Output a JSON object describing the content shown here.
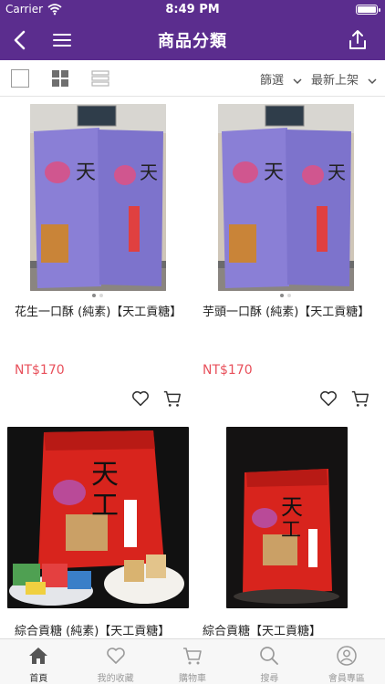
{
  "status_bar": {
    "carrier": "Carrier",
    "time": "8:49 PM"
  },
  "nav": {
    "title": "商品分類"
  },
  "toolbar": {
    "filter_label": "篩選",
    "sort_label": "最新上架"
  },
  "products": [
    {
      "name": "花生一口酥 (純素)【天工貢糖】",
      "price": "NT$170",
      "image": "purple-candy-bags"
    },
    {
      "name": "芋頭一口酥 (純素)【天工貢糖】",
      "price": "NT$170",
      "image": "purple-candy-bags"
    },
    {
      "name": "綜合貢糖 (純素)【天工貢糖】",
      "price": "",
      "image": "red-bag-with-sweets"
    },
    {
      "name": "綜合貢糖【天工貢糖】",
      "price": "",
      "image": "red-bag-dark-background"
    }
  ],
  "tabs": [
    {
      "label": "首頁",
      "icon": "home-icon",
      "active": true
    },
    {
      "label": "我的收藏",
      "icon": "heart-icon",
      "active": false
    },
    {
      "label": "購物車",
      "icon": "cart-icon",
      "active": false
    },
    {
      "label": "搜尋",
      "icon": "search-icon",
      "active": false
    },
    {
      "label": "會員專區",
      "icon": "user-icon",
      "active": false
    }
  ],
  "colors": {
    "brand": "#5b2d8e",
    "price": "#e8505b"
  }
}
